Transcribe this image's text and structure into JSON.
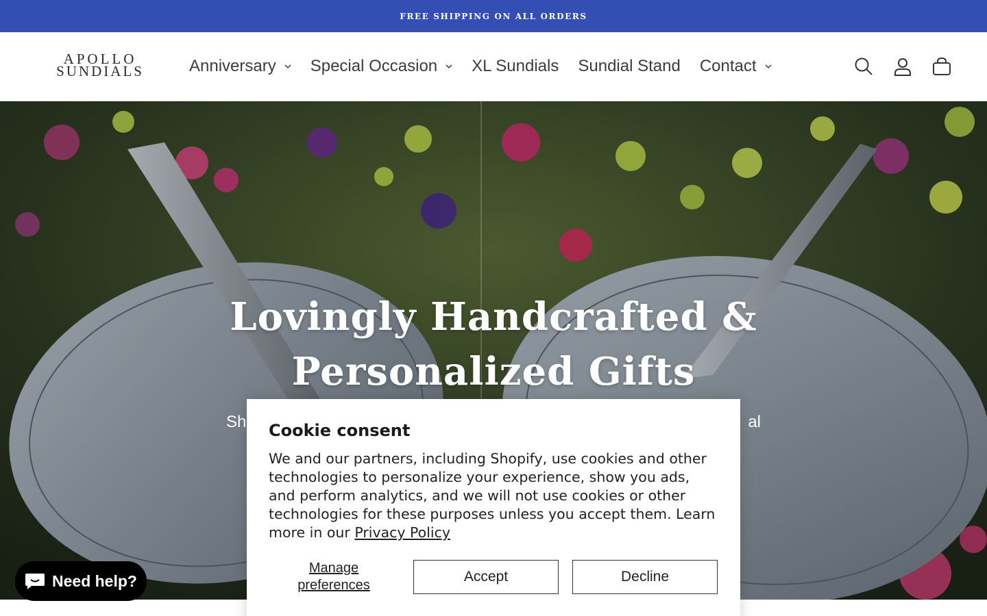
{
  "announcement": {
    "text": "FREE SHIPPING ON ALL ORDERS",
    "bg": "#334fb4"
  },
  "logo": {
    "line1": "APOLLO",
    "line2": "SUNDIALS"
  },
  "nav": {
    "items": [
      {
        "label": "Anniversary",
        "dropdown": true
      },
      {
        "label": "Special Occasion",
        "dropdown": true
      },
      {
        "label": "XL Sundials",
        "dropdown": false
      },
      {
        "label": "Sundial Stand",
        "dropdown": false
      },
      {
        "label": "Contact",
        "dropdown": true
      }
    ]
  },
  "header_icons": [
    "search-icon",
    "account-icon",
    "cart-icon"
  ],
  "hero": {
    "title_line1": "Lovingly Handcrafted &",
    "title_line2": "Personalized Gifts",
    "subtitle_left": "Sh",
    "subtitle_right": "al"
  },
  "cookie": {
    "title": "Cookie consent",
    "body": "We and our partners, including Shopify, use cookies and other technologies to personalize your experience, show you ads, and perform analytics, and we will not use cookies or other technologies for these purposes unless you accept them. Learn more in our ",
    "link": "Privacy Policy",
    "manage_line1": "Manage",
    "manage_line2": "preferences",
    "accept": "Accept",
    "decline": "Decline"
  },
  "chat": {
    "label": "Need help?"
  }
}
